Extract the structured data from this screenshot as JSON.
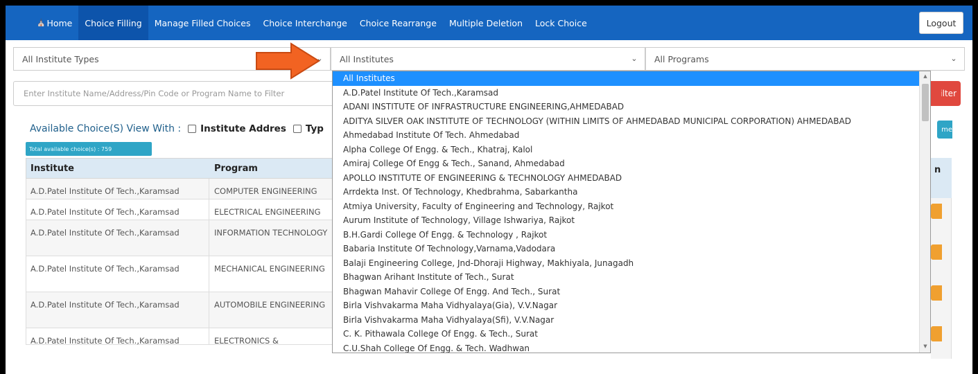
{
  "nav": {
    "items": [
      {
        "label": "Home",
        "active": false
      },
      {
        "label": "Choice Filling",
        "active": true
      },
      {
        "label": "Manage Filled Choices",
        "active": false
      },
      {
        "label": "Choice Interchange",
        "active": false
      },
      {
        "label": "Choice Rearrange",
        "active": false
      },
      {
        "label": "Multiple Deletion",
        "active": false
      },
      {
        "label": "Lock Choice",
        "active": false
      }
    ],
    "logout_label": "Logout"
  },
  "filters": {
    "institute_type": "All Institute Types",
    "institute": "All Institutes",
    "program": "All Programs",
    "search_placeholder": "Enter Institute Name/Address/Pin Code or Program Name to Filter",
    "filter_label": "Filter"
  },
  "view": {
    "label": "Available Choice(S) View With :",
    "option_address": "Institute Addres",
    "option_type": "Typ",
    "total_badge": "Total available choice(s) : 759",
    "right_button": "me"
  },
  "table": {
    "headers": [
      "Institute",
      "Program"
    ],
    "right_header": "n",
    "rows": [
      {
        "institute": "A.D.Patel Institute Of Tech.,Karamsad",
        "program": "COMPUTER ENGINEERING"
      },
      {
        "institute": "A.D.Patel Institute Of Tech.,Karamsad",
        "program": "ELECTRICAL ENGINEERING"
      },
      {
        "institute": "A.D.Patel Institute Of Tech.,Karamsad",
        "program": "INFORMATION TECHNOLOGY"
      },
      {
        "institute": "A.D.Patel Institute Of Tech.,Karamsad",
        "program": "MECHANICAL ENGINEERING"
      },
      {
        "institute": "A.D.Patel Institute Of Tech.,Karamsad",
        "program": "AUTOMOBILE ENGINEERING"
      },
      {
        "institute": "A.D.Patel Institute Of Tech.,Karamsad",
        "program": "ELECTRONICS &"
      }
    ]
  },
  "dropdown": {
    "options": [
      "All Institutes",
      "A.D.Patel Institute Of Tech.,Karamsad",
      "ADANI INSTITUTE OF INFRASTRUCTURE ENGINEERING,AHMEDABAD",
      "ADITYA SILVER OAK INSTITUTE OF TECHNOLOGY (WITHIN LIMITS OF AHMEDABAD MUNICIPAL CORPORATION) AHMEDABAD",
      "Ahmedabad Institute Of Tech. Ahmedabad",
      "Alpha College Of Engg. & Tech., Khatraj, Kalol",
      "Amiraj College Of Engg & Tech., Sanand, Ahmedabad",
      "APOLLO INSTITUTE OF ENGINEERING & TECHNOLOGY AHMEDABAD",
      "Arrdekta Inst. Of Technology, Khedbrahma, Sabarkantha",
      "Atmiya University, Faculty of Engineering and Technology, Rajkot",
      "Aurum Institute of Technology, Village Ishwariya, Rajkot",
      "B.H.Gardi College Of Engg. & Technology , Rajkot",
      "Babaria Institute Of Technology,Varnama,Vadodara",
      "Balaji Engineering College, Jnd-Dhoraji Highway, Makhiyala, Junagadh",
      "Bhagwan Arihant Institute of Tech., Surat",
      "Bhagwan Mahavir College Of Engg. And Tech., Surat",
      "Birla Vishvakarma Maha Vidhyalaya(Gia), V.V.Nagar",
      "Birla Vishvakarma Maha Vidhyalaya(Sfi), V.V.Nagar",
      "C. K. Pithawala College Of Engg. & Tech., Surat",
      "C.U.Shah College Of Engg. & Tech. Wadhwan"
    ],
    "selected_index": 0
  },
  "colors": {
    "navbar": "#1565c0",
    "selected_option": "#1e90ff",
    "filter_button": "#e0483e",
    "annotation_arrow": "#f26322",
    "badge": "#2fa5c6",
    "table_header": "#dbe9f4"
  }
}
